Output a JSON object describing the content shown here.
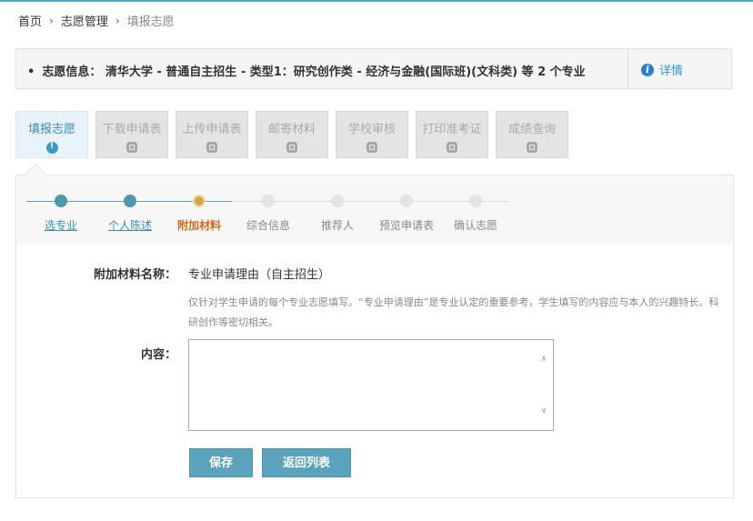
{
  "breadcrumb": {
    "items": [
      "首页",
      "志愿管理",
      "填报志愿"
    ],
    "separator": "›"
  },
  "info": {
    "bullet": "•",
    "label": "志愿信息：",
    "text": "清华大学 - 普通自主招生 - 类型1：研究创作类 - 经济与金融(国际班)(文科类) 等 2 个专业",
    "detail_icon": "info-icon",
    "detail_link": "详情"
  },
  "tabs": [
    {
      "label": "填报志愿",
      "icon": "alert-icon",
      "active": true
    },
    {
      "label": "下载申请表",
      "icon": "lock-icon",
      "active": false
    },
    {
      "label": "上传申请表",
      "icon": "lock-icon",
      "active": false
    },
    {
      "label": "邮寄材料",
      "icon": "lock-icon",
      "active": false
    },
    {
      "label": "学校审核",
      "icon": "lock-icon",
      "active": false
    },
    {
      "label": "打印准考证",
      "icon": "lock-icon",
      "active": false
    },
    {
      "label": "成绩查询",
      "icon": "lock-icon",
      "active": false
    }
  ],
  "steps": [
    {
      "label": "选专业",
      "state": "done"
    },
    {
      "label": "个人陈述",
      "state": "done"
    },
    {
      "label": "附加材料",
      "state": "current"
    },
    {
      "label": "综合信息",
      "state": "todo"
    },
    {
      "label": "推荐人",
      "state": "todo"
    },
    {
      "label": "预览申请表",
      "state": "todo"
    },
    {
      "label": "确认志愿",
      "state": "todo"
    }
  ],
  "form": {
    "material_name_label": "附加材料名称：",
    "material_name_value": "专业申请理由（自主招生）",
    "hint": "仅针对学生申请的每个专业志愿填写。“专业申请理由”是专业认定的重要参考，学生填写的内容应与本人的兴趣特长、科研创作等密切相关。",
    "content_label": "内容：",
    "content_value": ""
  },
  "buttons": {
    "save": "保存",
    "back": "返回列表"
  },
  "colors": {
    "accent": "#5ba3bd",
    "link": "#2a9bd0",
    "current_step": "#d26a1e",
    "top_line": "#4fa8c0"
  }
}
